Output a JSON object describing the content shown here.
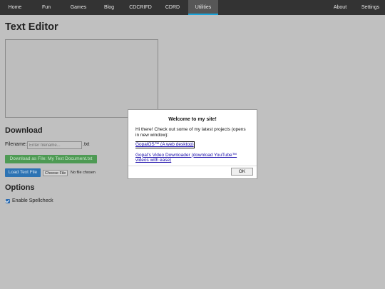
{
  "nav": {
    "left_items": [
      {
        "label": "Home"
      },
      {
        "label": "Fun"
      },
      {
        "label": "Games"
      },
      {
        "label": "Blog"
      },
      {
        "label": "CDCRIFD"
      },
      {
        "label": "CDRD"
      },
      {
        "label": "Utilities",
        "active": true
      }
    ],
    "right_items": [
      {
        "label": "About"
      },
      {
        "label": "Settings"
      }
    ],
    "accent_color": "#1aa3d9"
  },
  "page": {
    "title": "Text Editor",
    "download_heading": "Download",
    "filename_label": "Filename:",
    "filename_placeholder": "Enter filename...",
    "filename_value": "",
    "filename_ext": ".txt",
    "download_button": "Download as File: My Text Document.txt",
    "load_button": "Load Text File",
    "choose_file_button": "Choose File",
    "no_file_text": "No file chosen",
    "options_heading": "Options",
    "spellcheck_label": "Enable Spellcheck",
    "spellcheck_checked": true,
    "download_color": "#4e9a54",
    "load_color": "#2d73b3"
  },
  "modal": {
    "title": "Welcome to my site!",
    "intro": "Hi there! Check out some of my latest projects (opens in new window):",
    "links": [
      {
        "label": "GopalOS™ (A web desktop)"
      },
      {
        "label": "Gopal's Video Downloader (download YouTube™ videos with ease)"
      }
    ],
    "ok_button": "OK"
  }
}
